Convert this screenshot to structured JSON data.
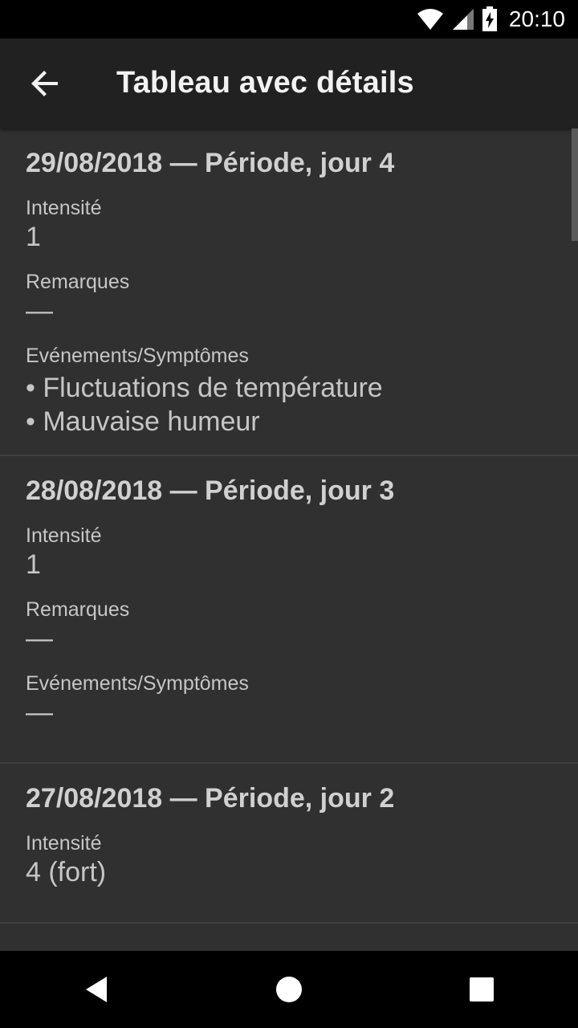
{
  "status_bar": {
    "time": "20:10",
    "icons": [
      "wifi-icon",
      "signal-icon",
      "battery-charging-icon"
    ]
  },
  "app_bar": {
    "back_icon": "arrow-back-icon",
    "title": "Tableau avec détails"
  },
  "entries": [
    {
      "header": "29/08/2018 — Période, jour 4",
      "intensity_label": "Intensité",
      "intensity_value": "1",
      "remarks_label": "Remarques",
      "remarks_value": "—",
      "events_label": "Evénements/Symptômes",
      "events": [
        "Fluctuations de température",
        "Mauvaise humeur"
      ]
    },
    {
      "header": "28/08/2018 — Période, jour 3",
      "intensity_label": "Intensité",
      "intensity_value": "1",
      "remarks_label": "Remarques",
      "remarks_value": "—",
      "events_label": "Evénements/Symptômes",
      "events_value": "—"
    },
    {
      "header": "27/08/2018 — Période, jour 2",
      "intensity_label": "Intensité",
      "intensity_value": "4 (fort)"
    }
  ],
  "nav_bar": {
    "icons": [
      "back-triangle-icon",
      "home-circle-icon",
      "recents-square-icon"
    ]
  }
}
